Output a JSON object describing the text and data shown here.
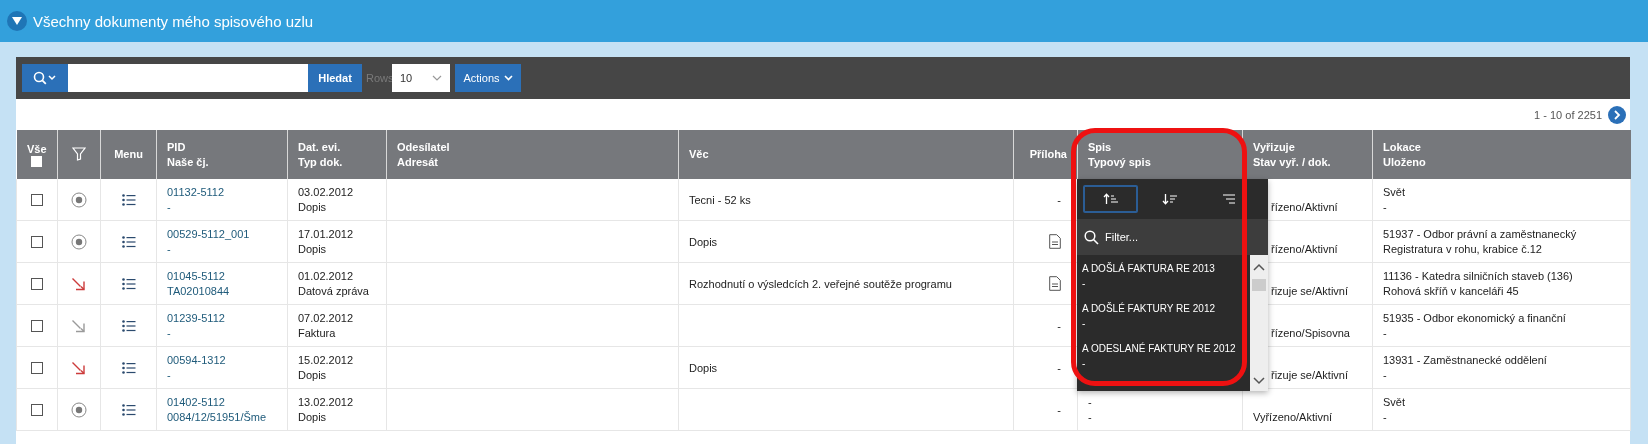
{
  "title": "Všechny dokumenty mého spisového uzlu",
  "toolbar": {
    "search_label": "Hledat",
    "rows_label": "Rows",
    "rows_value": "10",
    "actions_label": "Actions"
  },
  "pagination": "1 - 10 of 2251",
  "columns": [
    {
      "kind": "select-all",
      "lines": [
        "Vše"
      ],
      "checked": false
    },
    {
      "kind": "filter"
    },
    {
      "kind": "text-center",
      "lines": [
        "Menu"
      ]
    },
    {
      "kind": "text",
      "lines": [
        "PID",
        "Naše čj."
      ]
    },
    {
      "kind": "text",
      "lines": [
        "Dat. evi.",
        "Typ dok."
      ]
    },
    {
      "kind": "text",
      "lines": [
        "Odesílatel",
        "Adresát"
      ]
    },
    {
      "kind": "text",
      "lines": [
        "Věc"
      ]
    },
    {
      "kind": "text-right",
      "lines": [
        "Příloha"
      ]
    },
    {
      "kind": "text",
      "lines": [
        "Spis",
        "Typový spis"
      ]
    },
    {
      "kind": "text",
      "lines": [
        "Vyřizuje",
        "Stav vyř. / dok."
      ]
    },
    {
      "kind": "text",
      "lines": [
        "Lokace",
        "Uloženo"
      ]
    }
  ],
  "rows": [
    {
      "checked": false,
      "icon": {
        "kind": "dot"
      },
      "pid": [
        "01132-5112",
        "-"
      ],
      "date": [
        "03.02.2012",
        "Dopis"
      ],
      "subject": "Tecni - 52 ks",
      "attachment": {
        "kind": "text",
        "text": "-"
      },
      "handler": "řízeno/Aktivní",
      "location": [
        "Svět",
        "-"
      ]
    },
    {
      "checked": false,
      "icon": {
        "kind": "dot"
      },
      "pid": [
        "00529-5112_001",
        "-"
      ],
      "date": [
        "17.01.2012",
        "Dopis"
      ],
      "subject": "Dopis",
      "attachment": {
        "kind": "document"
      },
      "handler": "řízeno/Aktivní",
      "location": [
        "51937 - Odbor právní a zaměstnanecký",
        "Registratura v rohu, krabice č.12"
      ]
    },
    {
      "checked": false,
      "icon": {
        "kind": "arrow",
        "color": "#cc3b3b"
      },
      "pid": [
        "01045-5112",
        "TA02010844"
      ],
      "date": [
        "01.02.2012",
        "Datová zpráva"
      ],
      "subject": "Rozhodnutí o výsledcích 2. veřejné soutěže programu",
      "attachment": {
        "kind": "document"
      },
      "handler": "řizuje se/Aktivní",
      "location": [
        "11136 - Katedra silničních staveb (136)",
        "Rohová skříň v kanceláři 45"
      ]
    },
    {
      "checked": false,
      "icon": {
        "kind": "arrow",
        "color": "#9a9a9a"
      },
      "pid": [
        "01239-5112",
        "-"
      ],
      "date": [
        "07.02.2012",
        "Faktura"
      ],
      "attachment": {
        "kind": "text",
        "text": "-"
      },
      "handler": "řízeno/Spisovna",
      "location": [
        "51935 - Odbor ekonomický a finanční",
        "-"
      ]
    },
    {
      "checked": false,
      "icon": {
        "kind": "arrow",
        "color": "#cc3b3b"
      },
      "pid": [
        "00594-1312",
        "-"
      ],
      "date": [
        "15.02.2012",
        "Dopis"
      ],
      "subject": "Dopis",
      "attachment": {
        "kind": "text",
        "text": "-"
      },
      "handler": "řizuje se/Aktivní",
      "location": [
        "13931 - Zaměstnanecké oddělení",
        "-"
      ]
    },
    {
      "checked": false,
      "icon": {
        "kind": "dot"
      },
      "pid": [
        "01402-5112",
        "0084/12/51951/Šme"
      ],
      "date": [
        "13.02.2012",
        "Dopis"
      ],
      "attachment": {
        "kind": "text",
        "text": "-"
      },
      "file": [
        "-",
        "-"
      ],
      "handler": "Vyřízeno/Aktivní",
      "location": [
        "Svět",
        "-"
      ]
    }
  ],
  "column_menu": {
    "open": true,
    "sort_buttons": [
      {
        "kind": "asc",
        "selected": true
      },
      {
        "kind": "desc",
        "selected": false
      },
      {
        "kind": "hide",
        "selected": false
      }
    ],
    "filter_placeholder": "Filter...",
    "items": [
      {
        "title": "A DOŠLÁ FAKTURA RE 2013",
        "subtitle": "-"
      },
      {
        "title": "A DOŠLÉ FAKTURY RE 2012",
        "subtitle": "-"
      },
      {
        "title": "A ODESLANÉ FAKTURY RE 2012",
        "subtitle": "-"
      }
    ]
  }
}
